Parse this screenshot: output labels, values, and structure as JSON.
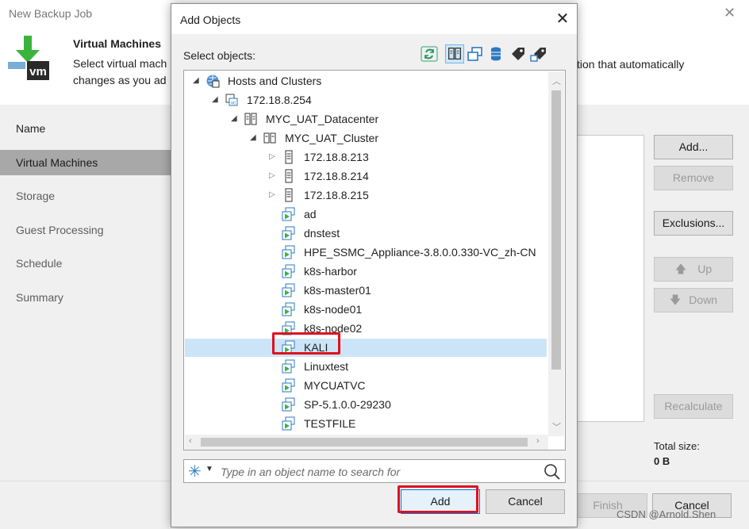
{
  "wizard": {
    "title": "New Backup Job",
    "header_title": "Virtual Machines",
    "header_desc_line1": "Select virtual mach",
    "header_desc_line2": "changes as you ad",
    "header_desc_right": "tion that automatically",
    "steps": [
      {
        "label": "Name",
        "state": "done"
      },
      {
        "label": "Virtual Machines",
        "state": "active"
      },
      {
        "label": "Storage",
        "state": "pending"
      },
      {
        "label": "Guest Processing",
        "state": "pending"
      },
      {
        "label": "Schedule",
        "state": "pending"
      },
      {
        "label": "Summary",
        "state": "pending"
      }
    ],
    "buttons": {
      "add": "Add...",
      "remove": "Remove",
      "exclusions": "Exclusions...",
      "up": "Up",
      "down": "Down",
      "recalculate": "Recalculate",
      "finish": "Finish",
      "cancel": "Cancel"
    },
    "total_size_label": "Total size:",
    "total_size_value": "0 B",
    "watermark": "CSDN @Arnold.Shen"
  },
  "dialog": {
    "title": "Add Objects",
    "select_label": "Select objects:",
    "toolbar_icons": [
      "refresh-icon",
      "hosts-clusters-view-icon",
      "vms-templates-view-icon",
      "datastores-view-icon",
      "tags-view-icon",
      "vm-tags-view-icon"
    ],
    "tree": {
      "root": "Hosts and Clusters",
      "vcenter": "172.18.8.254",
      "datacenter": "MYC_UAT_Datacenter",
      "cluster": "MYC_UAT_Cluster",
      "hosts": [
        "172.18.8.213",
        "172.18.8.214",
        "172.18.8.215"
      ],
      "vms": [
        "ad",
        "dnstest",
        "HPE_SSMC_Appliance-3.8.0.0.330-VC_zh-CN",
        "k8s-harbor",
        "k8s-master01",
        "k8s-node01",
        "k8s-node02",
        "KALI",
        "Linuxtest",
        "MYCUATVC",
        "SP-5.1.0.0-29230",
        "TESTFILE"
      ],
      "selected": "KALI"
    },
    "search_placeholder": "Type in an object name to search for",
    "add_label": "Add",
    "cancel_label": "Cancel"
  },
  "colors": {
    "selection": "#cce4f7",
    "highlight_box": "#e0101e",
    "vm_icon_green": "#3bb43b",
    "vm_icon_blue": "#2b79c2"
  }
}
